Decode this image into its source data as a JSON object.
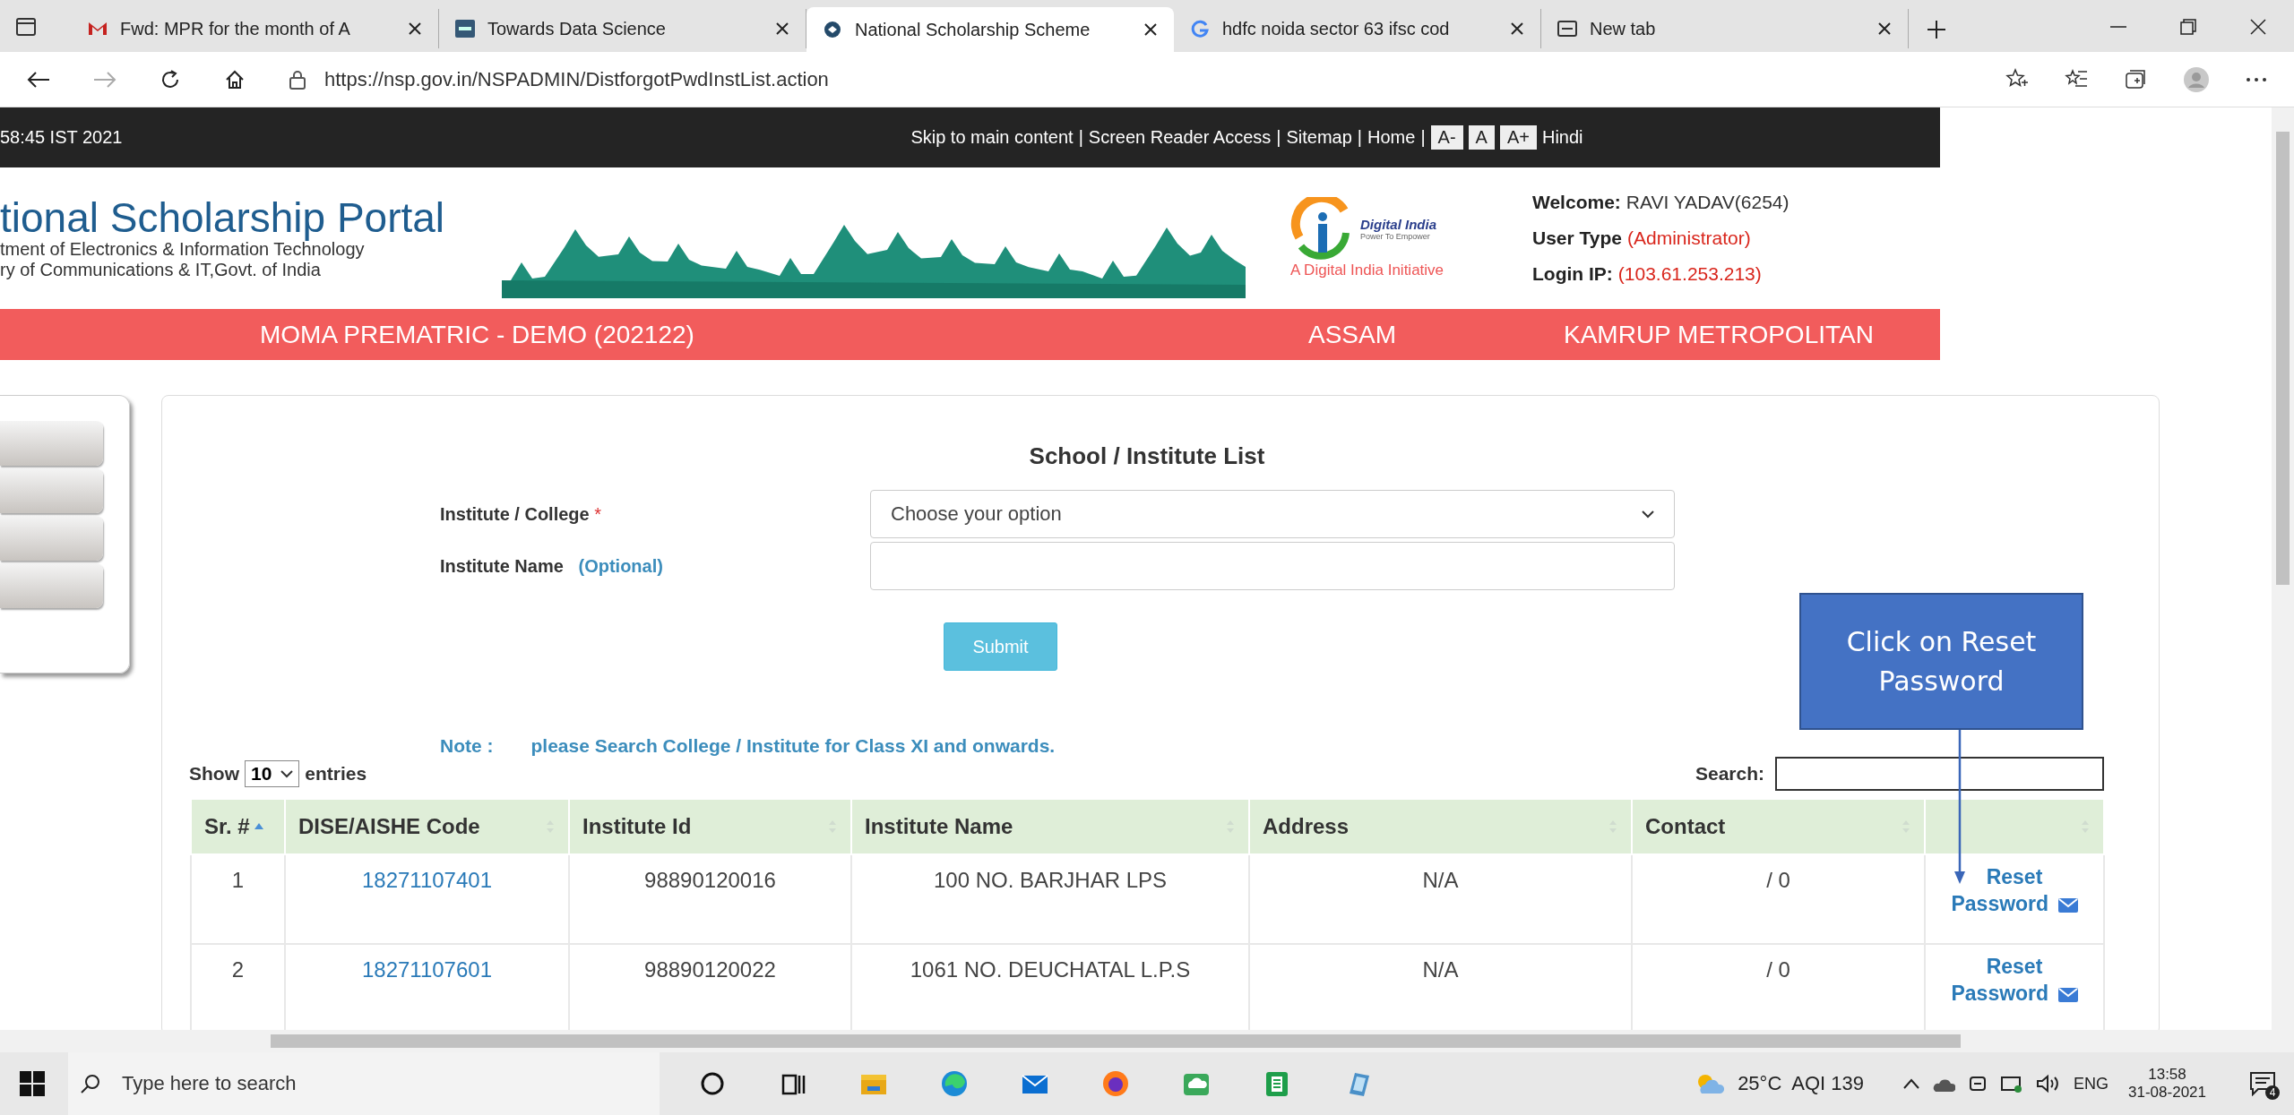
{
  "browser": {
    "tabs": [
      {
        "title": "Fwd: MPR for the month of A",
        "kind": "mail",
        "selected": false
      },
      {
        "title": "Towards Data Science",
        "kind": "site",
        "selected": false
      },
      {
        "title": "National Scholarship Scheme",
        "kind": "portal",
        "selected": true
      },
      {
        "title": "hdfc noida sector 63 ifsc cod",
        "kind": "search",
        "selected": false
      },
      {
        "title": "New tab",
        "kind": "newtab",
        "selected": false
      }
    ],
    "url": "https://nsp.gov.in/NSPADMIN/DistforgotPwdInstList.action"
  },
  "top_bar": {
    "datetime": "58:45 IST 2021",
    "items": [
      {
        "kind": "link",
        "text": "Skip to main content"
      },
      {
        "kind": "sep",
        "text": "|"
      },
      {
        "kind": "link",
        "text": "Screen Reader Access"
      },
      {
        "kind": "sep",
        "text": "|"
      },
      {
        "kind": "link",
        "text": "Sitemap"
      },
      {
        "kind": "sep",
        "text": "|"
      },
      {
        "kind": "link",
        "text": "Home"
      },
      {
        "kind": "sep",
        "text": "|"
      },
      {
        "kind": "font",
        "text": "A-"
      },
      {
        "kind": "font",
        "text": "A"
      },
      {
        "kind": "font",
        "text": "A+"
      },
      {
        "kind": "link",
        "text": "Hindi"
      }
    ]
  },
  "header": {
    "title": "tional Scholarship Portal",
    "subtitle_lines": [
      "tment of Electronics & Information Technology",
      "ry of Communications & IT,Govt. of India"
    ],
    "logo": {
      "name": "Digital India",
      "tagline": "Power To Empower",
      "caption": "A Digital India Initiative"
    },
    "user_info": [
      {
        "label": "Welcome:",
        "value": "RAVI YADAV(6254)"
      },
      {
        "label": "User Type",
        "value": "(Administrator)"
      },
      {
        "label": "Login IP:",
        "value": "(103.61.253.213)"
      }
    ]
  },
  "scheme_bar": {
    "scheme": "MOMA PREMATRIC - DEMO (202122)",
    "state": "ASSAM",
    "district": "KAMRUP METROPOLITAN"
  },
  "form": {
    "title": "School / Institute List",
    "fields": [
      {
        "kind": "select",
        "label": "Institute / College",
        "required_mark": "*",
        "value": "Choose your option"
      },
      {
        "kind": "text",
        "label": "Institute Name",
        "hint": "(Optional)"
      }
    ],
    "submit": "Submit",
    "note_label": "Note :",
    "note": "please Search College / Institute for Class XI and onwards."
  },
  "table": {
    "show_label": "Show",
    "page_size": "10",
    "entries_label": "entries",
    "search_label": "Search:",
    "columns": [
      {
        "label": "Sr. #",
        "sorted": true
      },
      {
        "label": "DISE/AISHE Code",
        "sorted": false
      },
      {
        "label": "Institute Id",
        "sorted": false
      },
      {
        "label": "Institute Name",
        "sorted": false
      },
      {
        "label": "Address",
        "sorted": false
      },
      {
        "label": "Contact",
        "sorted": false
      },
      {
        "sorted": false
      }
    ],
    "rows": [
      {
        "cells": [
          "1",
          "18271107401",
          "98890120016",
          "100 NO. BARJHAR LPS",
          "N/A",
          "/ 0"
        ],
        "action": "Reset Password"
      },
      {
        "cells": [
          "2",
          "18271107601",
          "98890120022",
          "1061 NO. DEUCHATAL L.P.S",
          "N/A",
          "/ 0"
        ],
        "action": "Reset Password"
      }
    ]
  },
  "callout": {
    "text": "Click on Reset Password"
  },
  "taskbar": {
    "search_placeholder": "Type here to search",
    "weather": "25°C  AQI 139",
    "language": "ENG",
    "time": "13:58",
    "date": "31-08-2021",
    "notifications": "4"
  }
}
